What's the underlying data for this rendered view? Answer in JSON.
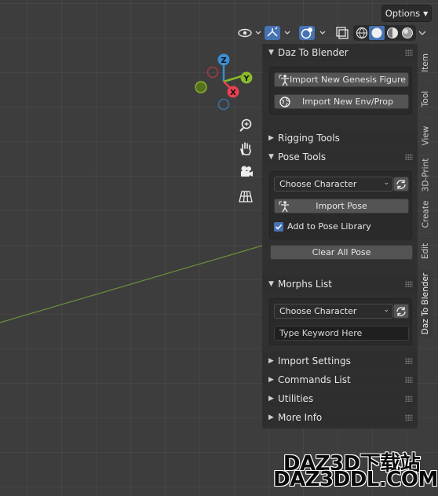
{
  "viewport": {
    "options_label": "Options",
    "gizmo": {
      "x_label": "X",
      "y_label": "Y",
      "z_label": "Z"
    }
  },
  "npanel": {
    "daz_to_blender": {
      "header": "Daz To Blender",
      "import_figure_label": "Import New Genesis Figure",
      "import_env_label": "Import New Env/Prop"
    },
    "rigging_tools": {
      "header": "Rigging Tools"
    },
    "pose_tools": {
      "header": "Pose Tools",
      "choose_character": "Choose Character",
      "import_pose_label": "Import Pose",
      "add_to_library_label": "Add to Pose Library",
      "add_to_library_checked": true,
      "clear_all_pose_label": "Clear All Pose"
    },
    "morphs_list": {
      "header": "Morphs List",
      "choose_character": "Choose Character",
      "keyword_placeholder": "Type Keyword Here"
    },
    "collapsed_sections": [
      "Import Settings",
      "Commands List",
      "Utilities",
      "More Info"
    ]
  },
  "tabs": [
    "Item",
    "Tool",
    "View",
    "3D-Print",
    "Create",
    "Edit",
    "Daz To Blender"
  ],
  "active_tab": "Daz To Blender",
  "watermark": {
    "line1": "DAZ3D下载站",
    "line2": "DAZ3DDL.COM"
  },
  "colors": {
    "x_axis": "#e8414f",
    "y_axis": "#8ab929",
    "z_axis": "#3a8ed4",
    "checkbox": "#4772b3"
  }
}
